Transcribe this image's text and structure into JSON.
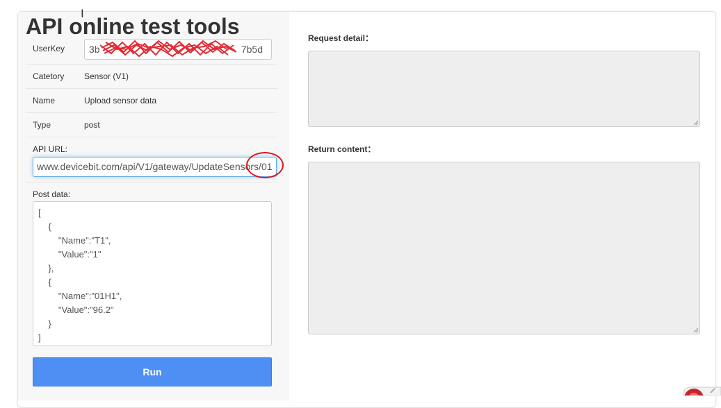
{
  "page": {
    "title": "API online test tools"
  },
  "form": {
    "userkey": {
      "label": "UserKey",
      "value_prefix": "3b",
      "value_suffix": "7b5d"
    },
    "category": {
      "label": "Catetory",
      "value": "Sensor (V1)"
    },
    "name": {
      "label": "Name",
      "value": "Upload sensor data"
    },
    "type": {
      "label": "Type",
      "value": "post"
    },
    "api_url": {
      "label": "API URL:",
      "value": "www.devicebit.com/api/V1/gateway/UpdateSensors/01"
    },
    "post_data": {
      "label": "Post data:",
      "value": "[\n    {\n        \"Name\":\"T1\",\n        \"Value\":\"1\"\n    },\n    {\n        \"Name\":\"01H1\",\n        \"Value\":\"96.2\"\n    }\n]"
    },
    "run_label": "Run"
  },
  "results": {
    "request_detail_label": "Request detail：",
    "return_content_label": "Return content："
  },
  "colors": {
    "run_button": "#4e8ff4",
    "annotation_red": "#e0141e",
    "focus_blue": "#66afe9"
  }
}
